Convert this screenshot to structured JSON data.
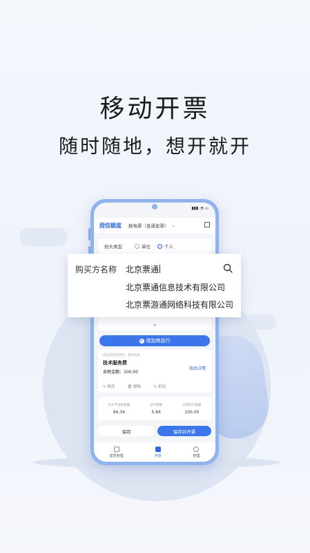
{
  "hero": {
    "title": "移动开票",
    "subtitle": "随时随地，想开就开"
  },
  "app": {
    "header": {
      "title": "授信额度",
      "invoice_type": "数电票（普通发票）",
      "dropdown_icon": "chevron-down-icon",
      "scan_icon": "scan-icon"
    },
    "title_type": {
      "label": "抬头类型",
      "options": [
        "单位",
        "个人"
      ],
      "selected": "个人"
    },
    "buyer_popup": {
      "label": "购买方名称",
      "value": "北京票通",
      "suggestions": [
        "北京票通信息技术有限公司",
        "北京票游通网络科技有限公司"
      ]
    },
    "expand_icon": "»",
    "add_item_label": "增加商品行",
    "item": {
      "hint": "商品或应税劳务、服务名称",
      "name": "技术服务费",
      "amount_label": "含税金额：",
      "amount": "100.00",
      "detail_link": "商品详情",
      "actions": [
        "修改",
        "删除",
        "折扣"
      ]
    },
    "totals": [
      {
        "label": "合计不含税金额",
        "value": "94.34"
      },
      {
        "label": "合计税额",
        "value": "5.66"
      },
      {
        "label": "价税合计金额",
        "value": "100.00"
      }
    ],
    "buttons": {
      "save": "保存",
      "save_and_issue": "保存并开票"
    },
    "tabs": [
      {
        "label": "发票管理",
        "icon": "document-icon"
      },
      {
        "label": "开票",
        "icon": "edit-icon"
      },
      {
        "label": "管理",
        "icon": "settings-icon"
      }
    ],
    "active_tab": "开票"
  },
  "colors": {
    "accent": "#3b76ea",
    "background": "#f1f5fb"
  }
}
